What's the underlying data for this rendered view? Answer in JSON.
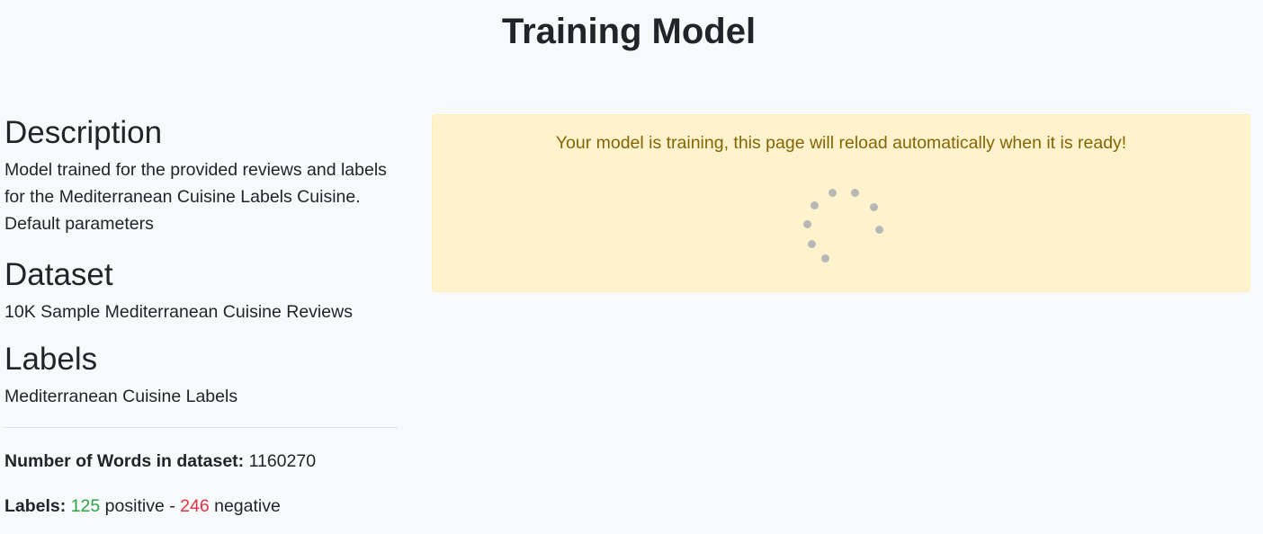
{
  "page": {
    "title": "Training Model"
  },
  "description": {
    "heading": "Description",
    "text": "Model trained for the provided reviews and labels for the Mediterranean Cuisine Labels Cuisine. Default parameters"
  },
  "dataset": {
    "heading": "Dataset",
    "name": "10K Sample Mediterranean Cuisine Reviews"
  },
  "labels": {
    "heading": "Labels",
    "name": "Mediterranean Cuisine Labels"
  },
  "stats": {
    "words_label": "Number of Words in dataset:",
    "words_value": "1160270",
    "labels_label": "Labels:",
    "positive_count": "125",
    "positive_text": "positive",
    "separator": "-",
    "negative_count": "246",
    "negative_text": "negative"
  },
  "alert": {
    "message": "Your model is training, this page will reload automatically when it is ready!",
    "spinner_icon": "loading-spinner-icon"
  },
  "colors": {
    "background": "#f8f9fa",
    "alert_background": "#fff3cd",
    "alert_text": "#856404",
    "positive": "#28a745",
    "negative": "#dc3545",
    "spinner_dot": "#b7b7b7"
  }
}
